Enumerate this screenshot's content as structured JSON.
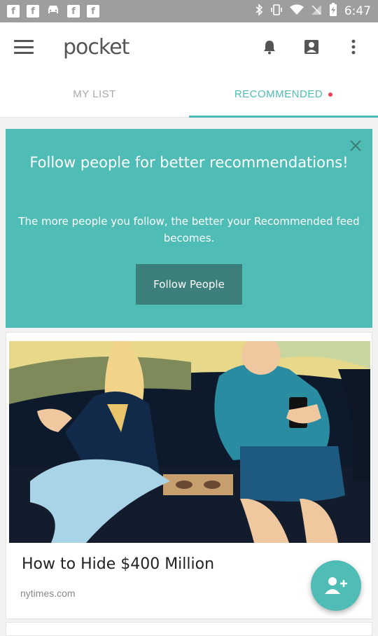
{
  "status_bar": {
    "time": "6:47",
    "notification_icons": [
      "f",
      "f",
      "f",
      "f"
    ]
  },
  "toolbar": {
    "logo": "pocket",
    "menu_icon": "hamburger-menu-icon",
    "actions": [
      "bell-icon",
      "profile-icon",
      "more-vertical-icon"
    ]
  },
  "tabs": [
    {
      "label": "MY LIST",
      "active": false
    },
    {
      "label": "RECOMMENDED",
      "active": true
    }
  ],
  "promo": {
    "title": "Follow people for better recommendations!",
    "body": "The more people you follow, the better your Recommended feed becomes.",
    "button": "Follow People",
    "close_icon": "close-icon"
  },
  "card": {
    "title": "How to Hide $400 Million",
    "source": "nytimes.com"
  },
  "fab": {
    "icon": "add-person-icon"
  },
  "colors": {
    "accent": "#50bcb6",
    "button_dark": "#3d7f7a",
    "badge": "#ef4056",
    "status_bar": "#9e9e9e"
  }
}
